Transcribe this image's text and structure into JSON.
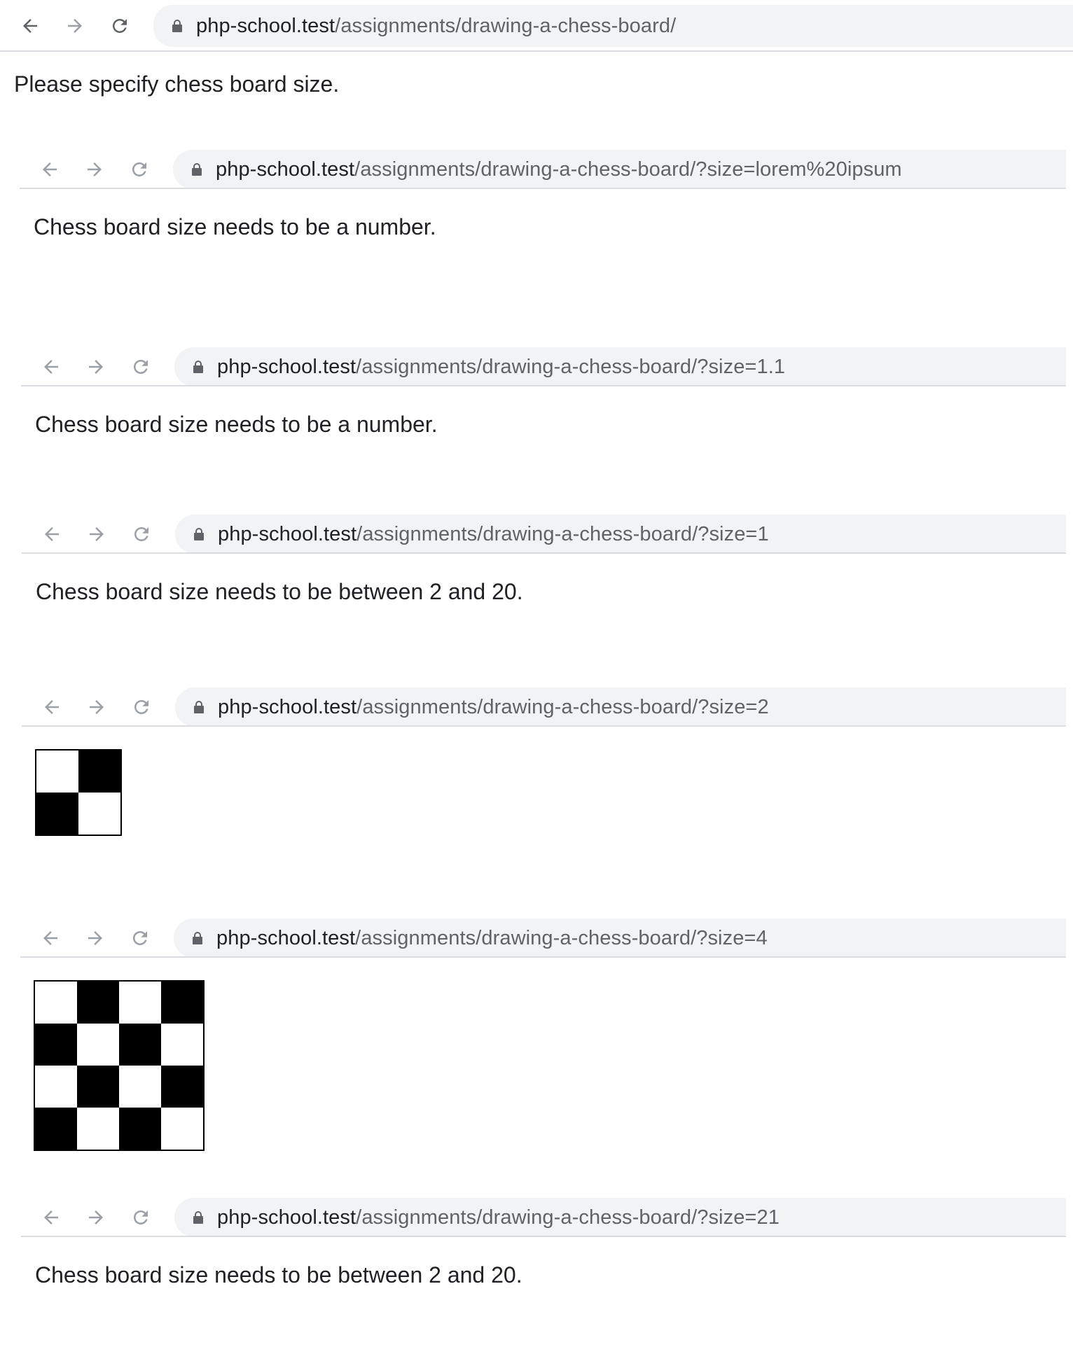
{
  "panels": [
    {
      "url_host": "php-school.test",
      "url_path": "/assignments/drawing-a-chess-board/",
      "message": "Please specify chess board size."
    },
    {
      "url_host": "php-school.test",
      "url_path": "/assignments/drawing-a-chess-board/?size=lorem%20ipsum",
      "message": "Chess board size needs to be a number."
    },
    {
      "url_host": "php-school.test",
      "url_path": "/assignments/drawing-a-chess-board/?size=1.1",
      "message": "Chess board size needs to be a number."
    },
    {
      "url_host": "php-school.test",
      "url_path": "/assignments/drawing-a-chess-board/?size=1",
      "message": "Chess board size needs to be between 2 and 20."
    },
    {
      "url_host": "php-school.test",
      "url_path": "/assignments/drawing-a-chess-board/?size=2",
      "board_size": 2
    },
    {
      "url_host": "php-school.test",
      "url_path": "/assignments/drawing-a-chess-board/?size=4",
      "board_size": 4
    },
    {
      "url_host": "php-school.test",
      "url_path": "/assignments/drawing-a-chess-board/?size=21",
      "message": "Chess board size needs to be between 2 and 20."
    }
  ],
  "icons": {
    "back": "back-arrow-icon",
    "forward": "forward-arrow-icon",
    "reload": "reload-icon",
    "lock": "lock-icon"
  },
  "colors": {
    "omnibox_bg": "#f1f3f4",
    "url_host": "#202124",
    "url_path": "#5f6368",
    "square_dark": "#000000",
    "square_light": "#ffffff"
  }
}
